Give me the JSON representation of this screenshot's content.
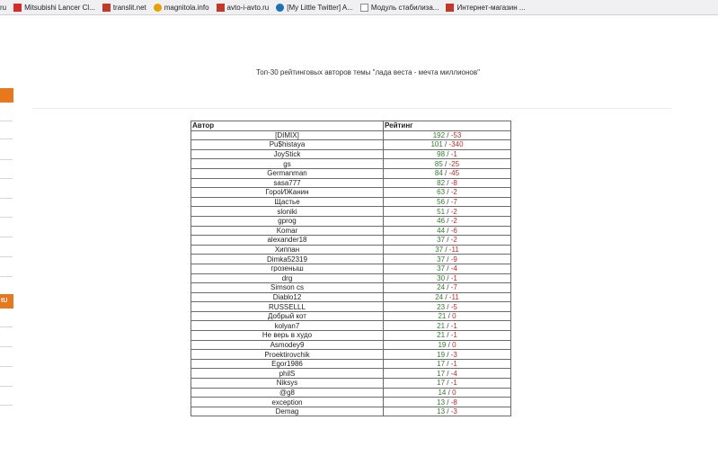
{
  "bookmarks": [
    {
      "label": "ru",
      "icon": "none"
    },
    {
      "label": "Mitsubishi Lancer Cl...",
      "icon": "mitsubishi-logo-icon",
      "color": "#d62b2b"
    },
    {
      "label": "translit.net",
      "icon": "t-logo-icon",
      "color": "#c0392b"
    },
    {
      "label": "magnitola.info",
      "icon": "magnitola-logo-icon",
      "color": "#e6a100"
    },
    {
      "label": "avto-i-avto.ru",
      "icon": "avto-logo-icon",
      "color": "#c0392b"
    },
    {
      "label": "[My Little Twitter] A...",
      "icon": "twitter-bird-icon",
      "color": "#1d6fb8"
    },
    {
      "label": "Модуль стабилиза...",
      "icon": "document-icon",
      "color": "#8a8a8a"
    },
    {
      "label": "Интернет-магазин ...",
      "icon": "web-icon",
      "color": "#c0392b"
    }
  ],
  "sidebar": {
    "badge_label": "tU"
  },
  "page": {
    "title": "Топ-30 рейтинговых авторов темы \"лада веста - мечта миллионов\""
  },
  "table": {
    "headers": [
      "Автор",
      "Рейтинг"
    ],
    "colors": {
      "positive": "#2e7d2e",
      "negative": "#c62828"
    },
    "rows": [
      {
        "author": "[DIMIX]",
        "pos": "192",
        "neg": "-53"
      },
      {
        "author": "Pu$histaya",
        "pos": "101",
        "neg": "-340"
      },
      {
        "author": "JoyStick",
        "pos": "98",
        "neg": "-1"
      },
      {
        "author": "gs",
        "pos": "85",
        "neg": "-25"
      },
      {
        "author": "Germanman",
        "pos": "84",
        "neg": "-45"
      },
      {
        "author": "sasa777",
        "pos": "82",
        "neg": "-8"
      },
      {
        "author": "ГороИЖанин",
        "pos": "63",
        "neg": "-2"
      },
      {
        "author": "Щастье",
        "pos": "56",
        "neg": "-7"
      },
      {
        "author": "sloniki",
        "pos": "51",
        "neg": "-2"
      },
      {
        "author": "gprog",
        "pos": "46",
        "neg": "-2"
      },
      {
        "author": "Komar",
        "pos": "44",
        "neg": "-6"
      },
      {
        "author": "alexander18",
        "pos": "37",
        "neg": "-2"
      },
      {
        "author": "Хиппан",
        "pos": "37",
        "neg": "-11"
      },
      {
        "author": "Dimka52319",
        "pos": "37",
        "neg": "-9"
      },
      {
        "author": "грозеныш",
        "pos": "37",
        "neg": "-4"
      },
      {
        "author": "drg",
        "pos": "30",
        "neg": "-1"
      },
      {
        "author": "Simson cs",
        "pos": "24",
        "neg": "-7"
      },
      {
        "author": "Diablo12",
        "pos": "24",
        "neg": "-11"
      },
      {
        "author": "RUSSELLL",
        "pos": "23",
        "neg": "-5"
      },
      {
        "author": "Добрый кот",
        "pos": "21",
        "neg": "0"
      },
      {
        "author": "kolyan7",
        "pos": "21",
        "neg": "-1"
      },
      {
        "author": "Не верь в худо",
        "pos": "21",
        "neg": "-1"
      },
      {
        "author": "Asmodey9",
        "pos": "19",
        "neg": "0"
      },
      {
        "author": "Proektirovchik",
        "pos": "19",
        "neg": "-3"
      },
      {
        "author": "Egor1986",
        "pos": "17",
        "neg": "-1"
      },
      {
        "author": "philS",
        "pos": "17",
        "neg": "-4"
      },
      {
        "author": "Niksys",
        "pos": "17",
        "neg": "-1"
      },
      {
        "author": "@g8",
        "pos": "14",
        "neg": "0"
      },
      {
        "author": "exception",
        "pos": "13",
        "neg": "-8"
      },
      {
        "author": "Demag",
        "pos": "13",
        "neg": "-3"
      }
    ]
  }
}
